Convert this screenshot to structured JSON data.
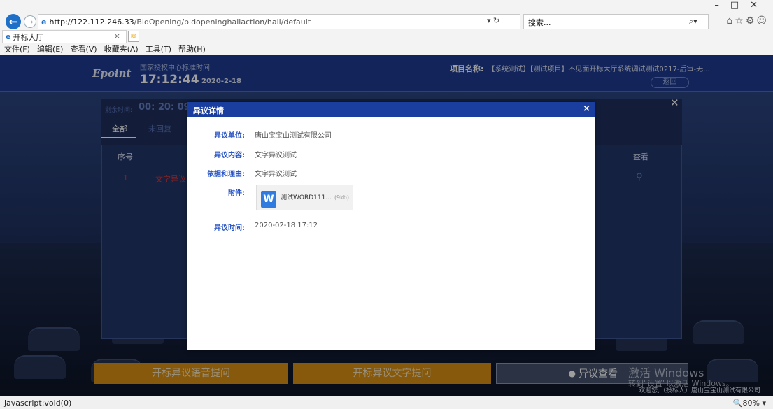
{
  "browser": {
    "url_host": "http://122.112.246.33",
    "url_path": "/BidOpening/bidopeninghallaction/hall/default",
    "url_controls": "▾ ↻",
    "search_placeholder": "搜索...",
    "search_icon": "⌕▾",
    "toolbar_icons": "⌂☆⚙☺",
    "window_buttons": "–□✕",
    "tab_title": "开标大厅",
    "tab_close": "×",
    "menu": [
      "文件(F)",
      "编辑(E)",
      "查看(V)",
      "收藏夹(A)",
      "工具(T)",
      "帮助(H)"
    ],
    "status_text": "javascript:void(0)",
    "zoom": "🔍80%  ▾"
  },
  "header": {
    "logo": "Epoint",
    "time_label": "国家授权中心标准时间",
    "clock": "17:12:44",
    "date": "2020-2-18",
    "project_label": "项目名称:",
    "project_value": "【系统测试】【测试项目】不见面开标大厅系统调试测试0217-后审-无...",
    "back_label": "返回"
  },
  "panel": {
    "remain_label": "剩余时间:",
    "remain_value": "00: 20: 09",
    "tab_all": "全部",
    "tab_unreplied": "未回复",
    "col_seq": "序号",
    "col_view": "查看",
    "row_seq": "1",
    "row_text": "文字异议测",
    "close": "✕"
  },
  "bottom": {
    "voice_button": "开标异议语音提问",
    "text_button": "开标异议文字提问",
    "view_button": "异议查看",
    "welcome": "欢迎您,（投标人）唐山宝宝山测试有限公司",
    "activate_title": "激活 Windows",
    "activate_sub": "转到\"设置\"以激活 Windows。"
  },
  "modal": {
    "title": "异议详情",
    "close": "×",
    "fields": [
      {
        "label": "异议单位:",
        "value": "唐山宝宝山测试有限公司"
      },
      {
        "label": "异议内容:",
        "value": "文字异议测试"
      },
      {
        "label": "依据和理由:",
        "value": "文字异议测试"
      },
      {
        "label": "附件:",
        "value": ""
      },
      {
        "label": "异议时间:",
        "value": "2020-02-18 17:12"
      }
    ],
    "attachment_name": "测试WORD111...",
    "attachment_size": "(9kb)",
    "attachment_icon": "W"
  },
  "colors": {
    "accent_blue": "#1a3ea0",
    "orange": "#d89014",
    "header_blue": "#1d3a92"
  }
}
